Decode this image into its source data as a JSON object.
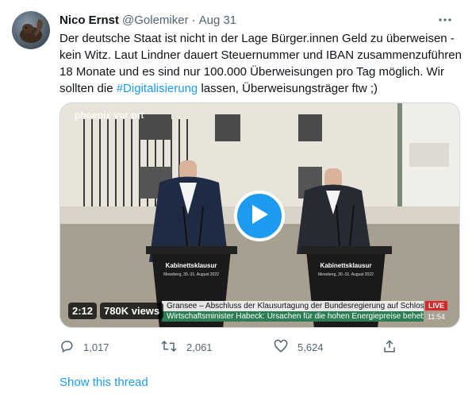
{
  "tweet": {
    "author_name": "Nico Ernst",
    "author_handle": "@Golemiker",
    "separator": "·",
    "date": "Aug 31",
    "more_icon": "more-horizontal-icon",
    "text_lines": [
      "Der deutsche Staat ist nicht in der Lage Bürger.innen Geld zu überweisen -",
      "kein Witz. Laut Lindner dauert Steuernummer und IBAN zusammenzuführen",
      "18 Monate und es sind nur 100.000 Überweisungen pro Tag möglich. Wir"
    ],
    "last_line_before": "sollten die ",
    "hashtag": "#Digitalisierung",
    "last_line_after": " lassen, Überweisungsträger ftw ;)"
  },
  "video": {
    "duration": "2:12",
    "views": "780K views",
    "logo": "phoenix vor ort",
    "podium_label": "Kabinettsklausur",
    "podium_sub": "Meseberg, 30.-31. August 2022",
    "ticker_line1": "Gransee – Abschluss der Klausurtagung der Bundesregierung auf Schloss Meseberg",
    "ticker_line2": "Wirtschaftsminister Habeck: Ursachen für die hohen Energiepreise beheben",
    "live": "LIVE",
    "time": "11:54",
    "play_icon": "play-icon"
  },
  "actions": {
    "reply_count": "1,017",
    "retweet_count": "2,061",
    "like_count": "5,624"
  },
  "show_thread": "Show this thread",
  "colors": {
    "accent": "#1d9bf0",
    "muted": "#536471",
    "text": "#0f1419"
  }
}
